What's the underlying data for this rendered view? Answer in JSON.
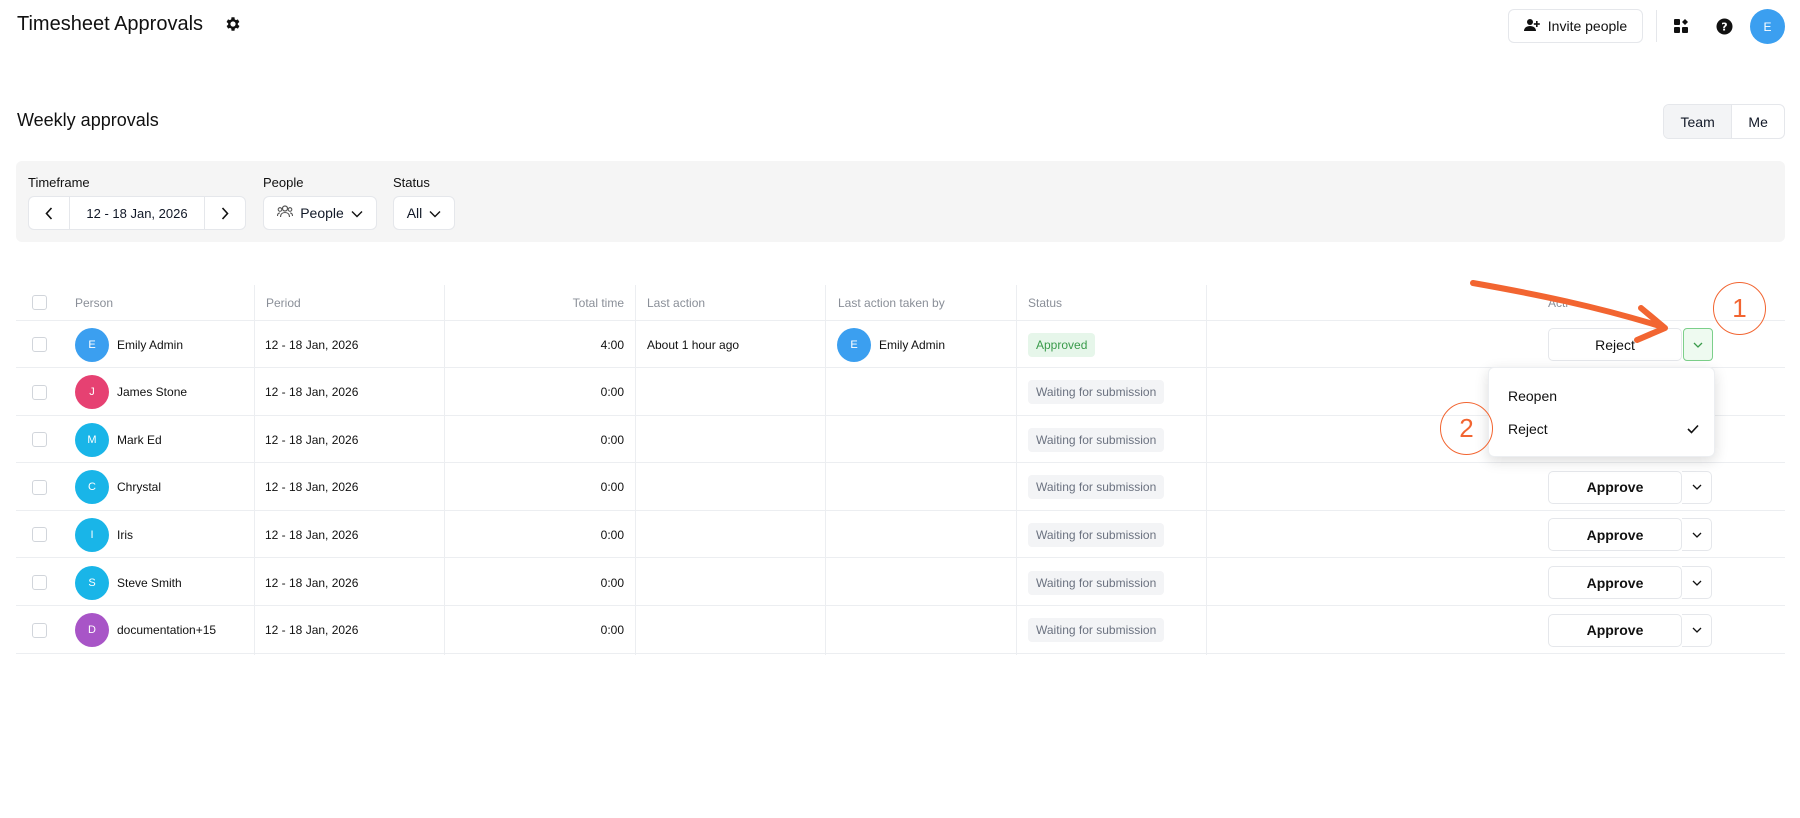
{
  "header": {
    "title": "Timesheet Approvals",
    "invite_label": "Invite people",
    "avatar_initial": "E"
  },
  "section": {
    "title": "Weekly approvals",
    "toggle": [
      "Team",
      "Me"
    ]
  },
  "filters": {
    "timeframe_label": "Timeframe",
    "timeframe_value": "12 - 18 Jan, 2026",
    "people_label": "People",
    "people_value": "People",
    "status_label": "Status",
    "status_value": "All"
  },
  "table": {
    "columns": [
      "Person",
      "Period",
      "Total time",
      "Last action",
      "Last action taken by",
      "Status",
      "Acti"
    ],
    "rows": [
      {
        "initial": "E",
        "color": "#3b9ff0",
        "name": "Emily Admin",
        "period": "12 - 18 Jan, 2026",
        "total": "4:00",
        "last_action": "About 1 hour ago",
        "taken_by_initial": "E",
        "taken_by": "Emily Admin",
        "status": "Approved",
        "action": "Reject"
      },
      {
        "initial": "J",
        "color": "#e64172",
        "name": "James Stone",
        "period": "12 - 18 Jan, 2026",
        "total": "0:00",
        "last_action": "",
        "taken_by_initial": "",
        "taken_by": "",
        "status": "Waiting for submission",
        "action": ""
      },
      {
        "initial": "M",
        "color": "#19b5e8",
        "name": "Mark Ed",
        "period": "12 - 18 Jan, 2026",
        "total": "0:00",
        "last_action": "",
        "taken_by_initial": "",
        "taken_by": "",
        "status": "Waiting for submission",
        "action": ""
      },
      {
        "initial": "C",
        "color": "#19b5e8",
        "name": "Chrystal",
        "period": "12 - 18 Jan, 2026",
        "total": "0:00",
        "last_action": "",
        "taken_by_initial": "",
        "taken_by": "",
        "status": "Waiting for submission",
        "action": "Approve"
      },
      {
        "initial": "I",
        "color": "#19b5e8",
        "name": "Iris",
        "period": "12 - 18 Jan, 2026",
        "total": "0:00",
        "last_action": "",
        "taken_by_initial": "",
        "taken_by": "",
        "status": "Waiting for submission",
        "action": "Approve"
      },
      {
        "initial": "S",
        "color": "#19b5e8",
        "name": "Steve Smith",
        "period": "12 - 18 Jan, 2026",
        "total": "0:00",
        "last_action": "",
        "taken_by_initial": "",
        "taken_by": "",
        "status": "Waiting for submission",
        "action": "Approve"
      },
      {
        "initial": "D",
        "color": "#a855c7",
        "name": "documentation+15",
        "period": "12 - 18 Jan, 2026",
        "total": "0:00",
        "last_action": "",
        "taken_by_initial": "",
        "taken_by": "",
        "status": "Waiting for submission",
        "action": "Approve"
      }
    ]
  },
  "menu": {
    "items": [
      "Reopen",
      "Reject"
    ],
    "selected": "Reject"
  },
  "annotations": {
    "step1": "1",
    "step2": "2",
    "color": "#f26531"
  },
  "icons": [
    "settings-gear-icon",
    "add-person-icon",
    "apps-icon",
    "help-icon",
    "chevron-left-icon",
    "chevron-right-icon",
    "people-icon",
    "chevron-down-icon",
    "checkmark-icon"
  ]
}
